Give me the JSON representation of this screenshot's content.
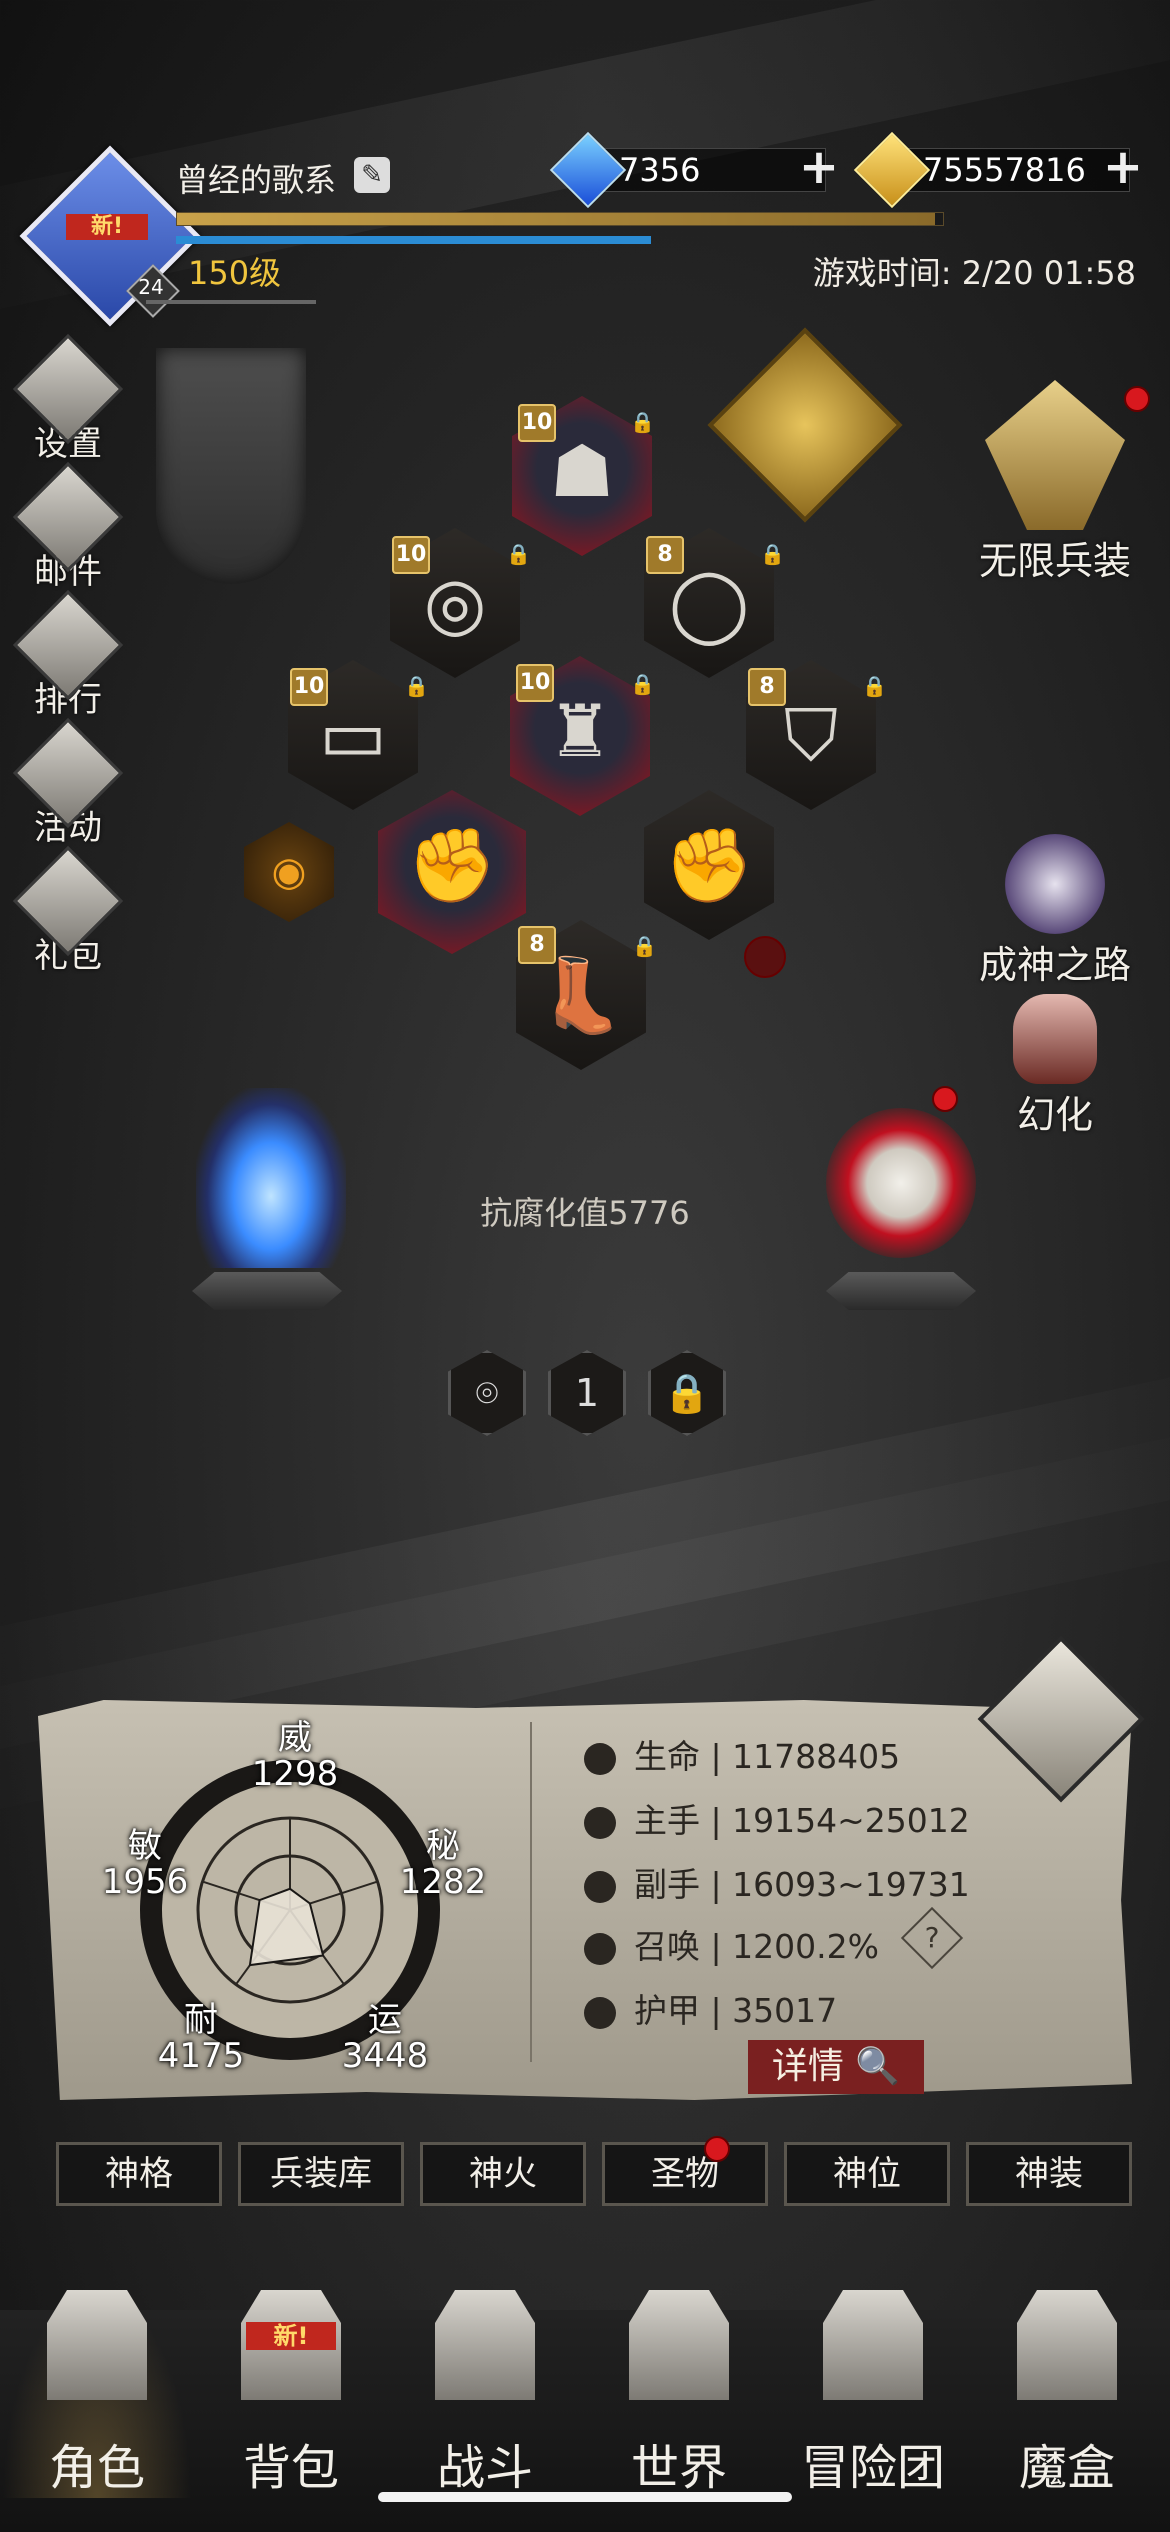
{
  "player": {
    "name": "曾经的歌系",
    "avatar_badge": "新!",
    "avatar_level": "24",
    "level": "150级",
    "xp_fraction": 0.99,
    "hp_fraction": 0.62
  },
  "currency": {
    "gems": "7356",
    "gold": "75557816"
  },
  "game_time": "游戏时间: 2/20 01:58",
  "left_menu": [
    {
      "label": "设置",
      "icon": "gear-icon"
    },
    {
      "label": "邮件",
      "icon": "mail-icon"
    },
    {
      "label": "排行榜",
      "icon": "ranking-icon"
    },
    {
      "label": "活动",
      "icon": "event-icon"
    },
    {
      "label": "礼包",
      "icon": "gift-icon"
    }
  ],
  "right_menu": {
    "infinite_arms": "无限兵装",
    "path_to_god": "成神之路",
    "transform": "幻化"
  },
  "equipment": [
    {
      "slot": "helmet",
      "level": "10"
    },
    {
      "slot": "amulet",
      "level": "10"
    },
    {
      "slot": "ring",
      "level": "8"
    },
    {
      "slot": "belt",
      "level": "10"
    },
    {
      "slot": "armor",
      "level": "10"
    },
    {
      "slot": "cloak",
      "level": "8"
    },
    {
      "slot": "main-hand",
      "level": ""
    },
    {
      "slot": "off-hand",
      "level": ""
    },
    {
      "slot": "boots",
      "level": "8"
    }
  ],
  "corruption_value": "抗腐化值5776",
  "page_selector": {
    "current": "1"
  },
  "attributes": {
    "wei": {
      "label": "威",
      "value": "1298"
    },
    "mi": {
      "label": "秘",
      "value": "1282"
    },
    "yun": {
      "label": "运",
      "value": "3448"
    },
    "nai": {
      "label": "耐",
      "value": "4175"
    },
    "min": {
      "label": "敏",
      "value": "1956"
    }
  },
  "stats": [
    {
      "label": "生命",
      "value": "11788405",
      "icon": "heart-icon"
    },
    {
      "label": "主手",
      "value": "19154~25012",
      "icon": "sword-icon"
    },
    {
      "label": "副手",
      "value": "16093~19731",
      "icon": "offhand-icon"
    },
    {
      "label": "召唤",
      "value": "1200.2%",
      "icon": "summon-icon"
    },
    {
      "label": "护甲",
      "value": "35017",
      "icon": "armor-icon"
    }
  ],
  "help_label": "?",
  "details_label": "详情",
  "tabs": [
    "神格",
    "兵装库",
    "神火",
    "圣物",
    "神位",
    "神装"
  ],
  "bottom_nav": [
    {
      "label": "角色",
      "icon": "helmet-icon"
    },
    {
      "label": "背包",
      "icon": "backpack-icon"
    },
    {
      "label": "战斗",
      "icon": "shield-swords-icon"
    },
    {
      "label": "世界",
      "icon": "map-icon"
    },
    {
      "label": "冒险团",
      "icon": "castle-icon"
    },
    {
      "label": "魔盒",
      "icon": "cube-icon"
    }
  ],
  "bottom_nav_badge": "新!",
  "colors": {
    "level_gold": "#f0c53e",
    "notification_red": "#d8181e",
    "details_button": "#7a2020"
  }
}
